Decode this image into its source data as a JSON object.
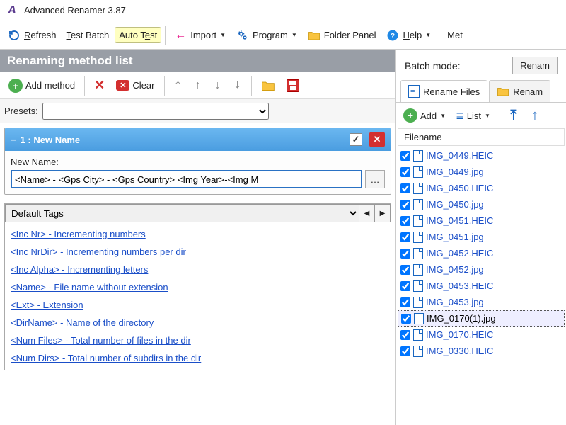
{
  "titlebar": {
    "title": "Advanced Renamer 3.87"
  },
  "toolbar": {
    "refresh": "Refresh",
    "test_batch": "Test Batch",
    "auto_test": "Auto Test",
    "import": "Import",
    "program": "Program",
    "folder_panel": "Folder Panel",
    "help": "Help",
    "met": "Met"
  },
  "left": {
    "header": "Renaming method list",
    "add_method": "Add method",
    "clear": "Clear",
    "presets_label": "Presets:",
    "method_title": "1 : New Name",
    "new_name_label": "New Name:",
    "new_name_value": "<Name> - <Gps City> - <Gps Country> <Img Year>-<Img M",
    "default_tags_label": "Default Tags",
    "tags": [
      "<Inc Nr> - Incrementing numbers",
      "<Inc NrDir> - Incrementing numbers per dir",
      "<Inc Alpha> - Incrementing letters",
      "<Name> - File name without extension",
      "<Ext> - Extension",
      "<DirName> - Name of the directory",
      "<Num Files> - Total number of files in the dir",
      "<Num Dirs> - Total number of subdirs in the dir"
    ]
  },
  "right": {
    "batch_mode_label": "Batch mode:",
    "batch_mode_value": "Renam",
    "tab_rename": "Rename Files",
    "tab_renam_folders": "Renam",
    "add": "Add",
    "list": "List",
    "filename_header": "Filename",
    "files": [
      {
        "name": "IMG_0449.HEIC",
        "selected": false
      },
      {
        "name": "IMG_0449.jpg",
        "selected": false
      },
      {
        "name": "IMG_0450.HEIC",
        "selected": false
      },
      {
        "name": "IMG_0450.jpg",
        "selected": false
      },
      {
        "name": "IMG_0451.HEIC",
        "selected": false
      },
      {
        "name": "IMG_0451.jpg",
        "selected": false
      },
      {
        "name": "IMG_0452.HEIC",
        "selected": false
      },
      {
        "name": "IMG_0452.jpg",
        "selected": false
      },
      {
        "name": "IMG_0453.HEIC",
        "selected": false
      },
      {
        "name": "IMG_0453.jpg",
        "selected": false
      },
      {
        "name": "IMG_0170(1).jpg",
        "selected": true
      },
      {
        "name": "IMG_0170.HEIC",
        "selected": false
      },
      {
        "name": "IMG_0330.HEIC",
        "selected": false
      }
    ]
  }
}
